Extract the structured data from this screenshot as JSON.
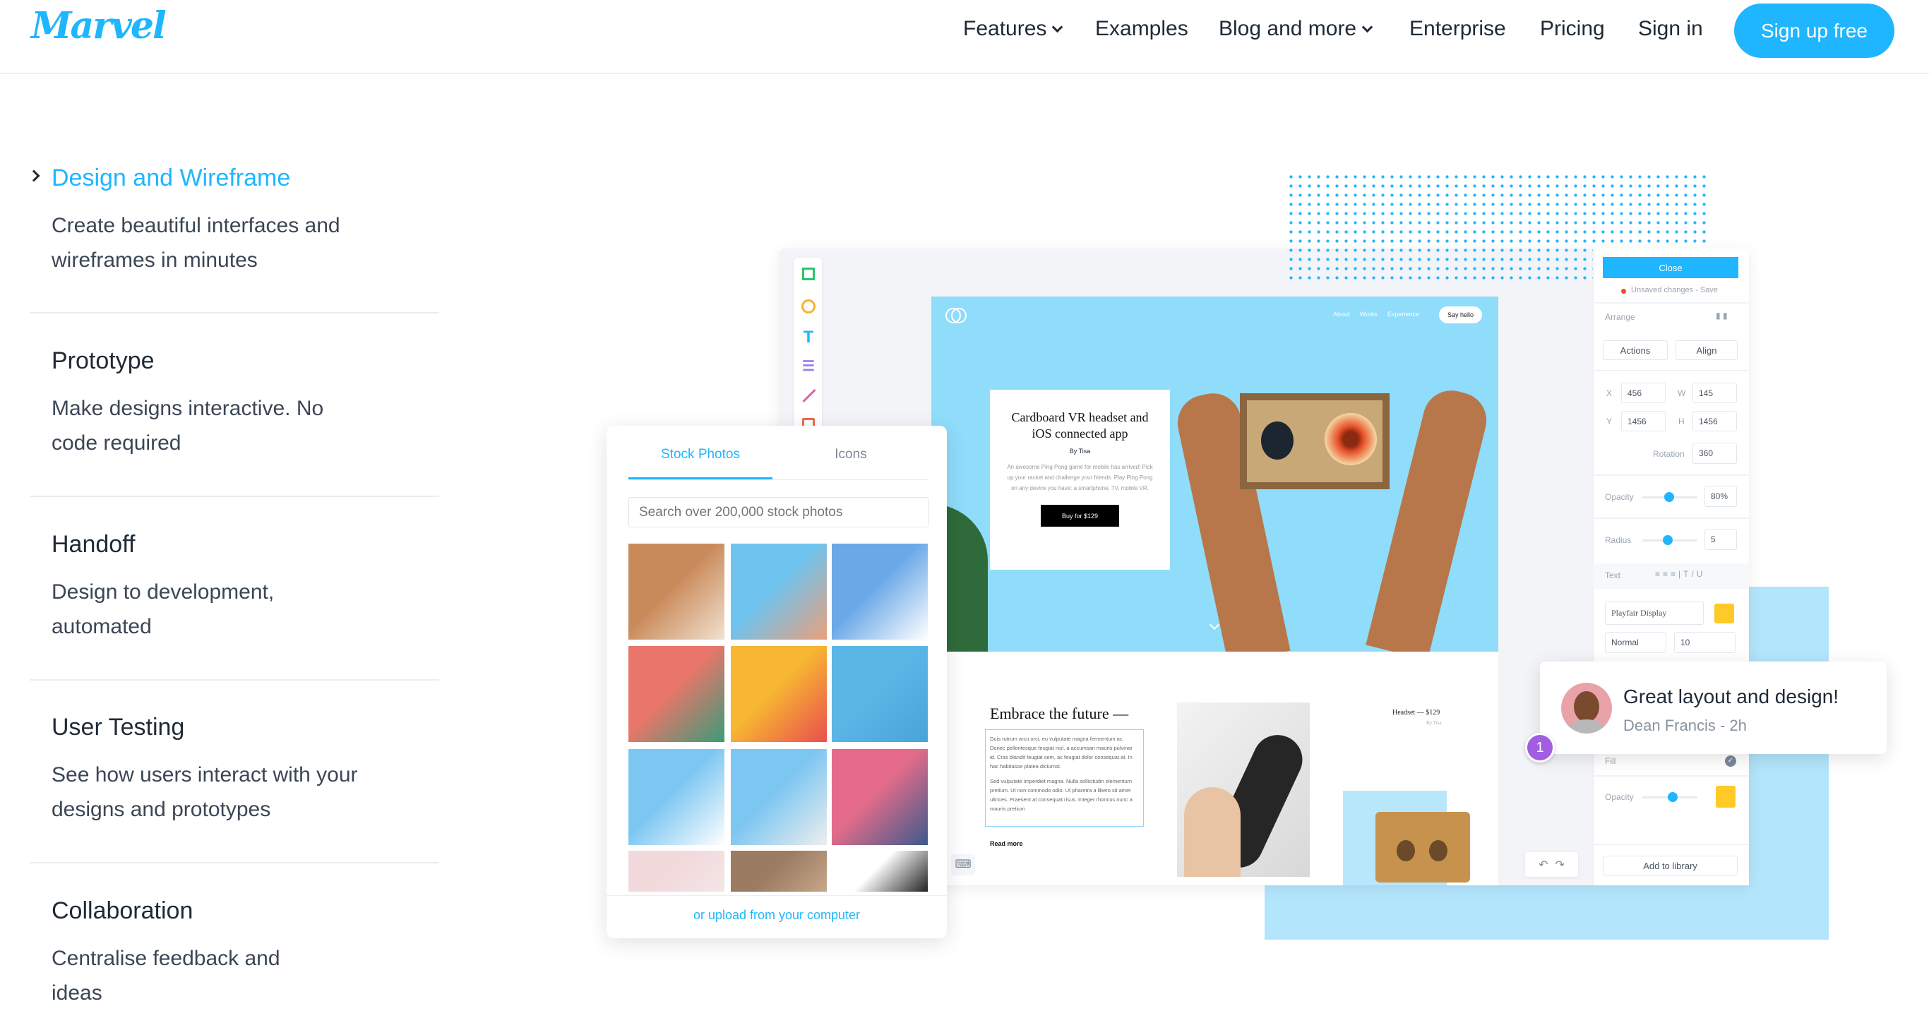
{
  "nav": {
    "logo": "Marvel",
    "items": [
      {
        "label": "Features",
        "dropdown": true
      },
      {
        "label": "Examples"
      },
      {
        "label": "Blog and more",
        "dropdown": true
      },
      {
        "label": "Enterprise"
      },
      {
        "label": "Pricing"
      },
      {
        "label": "Sign in"
      }
    ],
    "signup": "Sign up free",
    "accent": "#1fb6ff"
  },
  "features": [
    {
      "title": "Design and Wireframe",
      "desc": "Create beautiful interfaces and wireframes in minutes",
      "active": true
    },
    {
      "title": "Prototype",
      "desc": "Make designs interactive. No code required"
    },
    {
      "title": "Handoff",
      "desc": "Design to development, automated"
    },
    {
      "title": "User Testing",
      "desc": "See how users interact with your designs and prototypes"
    },
    {
      "title": "Collaboration",
      "desc": "Centralise feedback and ideas"
    }
  ],
  "canvas": {
    "nav": [
      "About",
      "Works",
      "Experience"
    ],
    "say_hello": "Say hello",
    "card_title": "Cardboard VR headset and iOS connected app",
    "card_by": "By Tisa",
    "card_desc": "An awesome Ping Pong game for mobile has arrived! Pick up your racket and challenge your friends. Play Ping Pong on any device you have: a smartphone, TV, mobile VR.",
    "buy": "Buy for $129",
    "embrace": "Embrace the future —",
    "body1": "Duis rutrum arcu orci, eu vulputate magna fermentum ac. Donec pellentesque feugiat nisl, a accumsan mauris pulvinar id. Cras blandit feugiat sem, ac feugiat dolor consequat at. In hac habitasse platea dictumst.",
    "body2": "Sed vulputate imperdiet magna. Nulla sollicitudin elementum pretium. Ut non commodo odio. Ut pharetra a libero sit amet ultrices. Praesent at consequat risus. Integer rhoncus nunc a mauris pretium",
    "read_more": "Read more",
    "product": "Headset — $129",
    "product_by": "By Tisa"
  },
  "panel": {
    "close": "Close",
    "unsaved": "Unsaved changes - Save",
    "arrange": "Arrange",
    "actions": "Actions",
    "align": "Align",
    "x_label": "X",
    "x": "456",
    "w_label": "W",
    "w": "145",
    "y_label": "Y",
    "y": "1456",
    "h_label": "H",
    "h": "1456",
    "rotation_label": "Rotation",
    "rotation": "360",
    "opacity_label": "Opacity",
    "opacity": "80%",
    "opacity_value": 0.5,
    "radius_label": "Radius",
    "radius": "5",
    "text_label": "Text",
    "font": "Playfair Display",
    "weight": "Normal",
    "size": "10",
    "fill_label": "Fill",
    "opacity2_label": "Opacity",
    "add_library": "Add to library",
    "swatch": "#ffc928"
  },
  "stock_panel": {
    "tabs": [
      {
        "label": "Stock Photos",
        "active": true
      },
      {
        "label": "Icons"
      }
    ],
    "search_placeholder": "Search over 200,000 stock photos",
    "upload": "or upload from your computer",
    "tiles": [
      [
        "#c98a5a",
        "#f1e2d0"
      ],
      [
        "#6fc3ef",
        "#e9a07a"
      ],
      [
        "#6aa8e8",
        "#ffffff"
      ],
      [
        "#e9766a",
        "#3a9b7a"
      ],
      [
        "#f7b733",
        "#e94e4e"
      ],
      [
        "#5bb6e6",
        "#4aa3d8"
      ],
      [
        "#7cc6f2",
        "#ffffff"
      ],
      [
        "#7cc6f2",
        "#eeeeee"
      ],
      [
        "#e46c8a",
        "#3b5a8c"
      ],
      [
        "#f2d9dc",
        "#f2e6e6"
      ],
      [
        "#9b7b62",
        "#c7a78a"
      ],
      [
        "#ffffff",
        "#222222"
      ]
    ]
  },
  "comment": {
    "text": "Great layout and design!",
    "author": "Dean Francis - 2h",
    "badge": "1",
    "badge_color": "#a25ee0"
  }
}
